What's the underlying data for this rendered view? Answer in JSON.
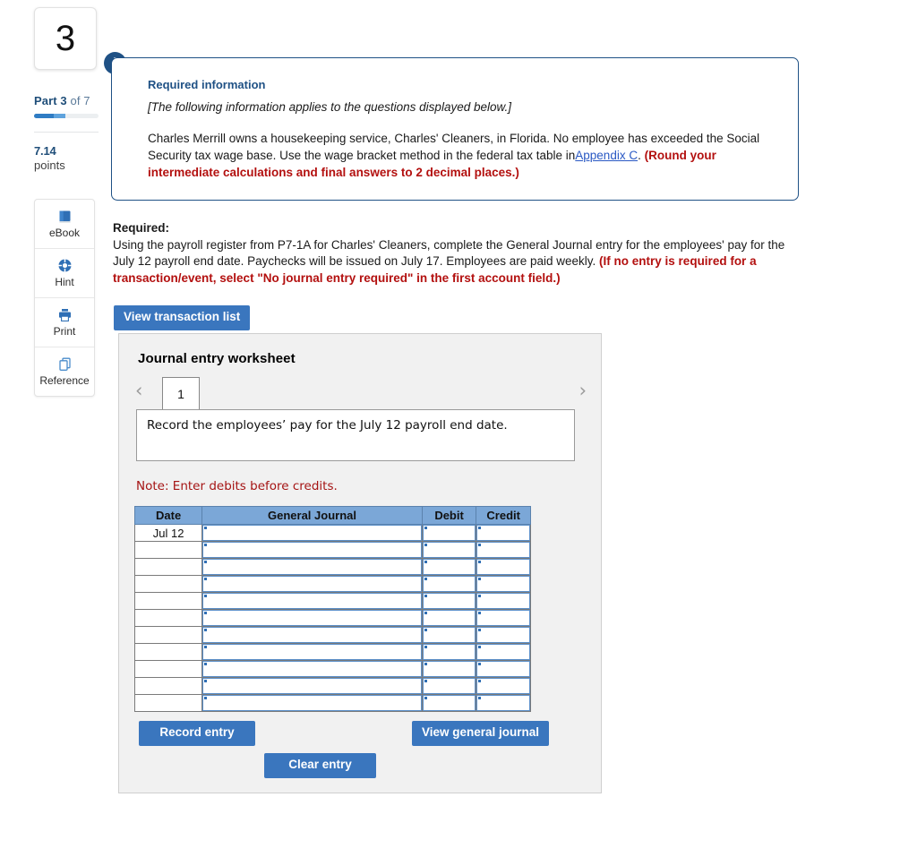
{
  "left_rail": {
    "question_number": "3",
    "part_prefix": "Part",
    "part_current": "3",
    "part_of": "of 7",
    "points_value": "7.14",
    "points_label": "points",
    "tools": [
      {
        "label": "eBook",
        "icon": "book-icon"
      },
      {
        "label": "Hint",
        "icon": "lifebuoy-icon"
      },
      {
        "label": "Print",
        "icon": "printer-icon"
      },
      {
        "label": "Reference",
        "icon": "copy-icon"
      }
    ]
  },
  "required_information": {
    "badge_icon": "exclamation-icon",
    "title": "Required information",
    "italic_note": "[The following information applies to the questions displayed below.]",
    "body_part1": "Charles Merrill owns a housekeeping service, Charles' Cleaners, in Florida. No employee has exceeded the Social Security tax wage base. Use the wage bracket method in the federal tax table in",
    "link_text": "Appendix C",
    "body_part2": ". ",
    "body_red": "(Round your intermediate calculations and final answers to 2 decimal places.)"
  },
  "required_block": {
    "heading": "Required:",
    "body_black": "Using the payroll register from P7-1A for Charles' Cleaners, complete the General Journal entry for the employees' pay for the July 12 payroll end date. Paychecks will be issued on July 17. Employees are paid weekly. ",
    "body_red": "(If no entry is required for a transaction/event, select \"No journal entry required\" in the first account field.)"
  },
  "toolbar": {
    "view_transaction_list_label": "View transaction list"
  },
  "worksheet": {
    "title": "Journal entry worksheet",
    "pager_prev_icon": "chevron-left-icon",
    "pager_next_icon": "chevron-right-icon",
    "pager_tabs": [
      "1"
    ],
    "active_tab": "1",
    "transaction_description": "Record the employees’ pay for the July 12 payroll end date.",
    "note": "Note: Enter debits before credits.",
    "table": {
      "headers": [
        "Date",
        "General Journal",
        "Debit",
        "Credit"
      ],
      "rows": [
        {
          "date": "Jul 12",
          "general_journal": "",
          "debit": "",
          "credit": ""
        },
        {
          "date": "",
          "general_journal": "",
          "debit": "",
          "credit": ""
        },
        {
          "date": "",
          "general_journal": "",
          "debit": "",
          "credit": ""
        },
        {
          "date": "",
          "general_journal": "",
          "debit": "",
          "credit": ""
        },
        {
          "date": "",
          "general_journal": "",
          "debit": "",
          "credit": ""
        },
        {
          "date": "",
          "general_journal": "",
          "debit": "",
          "credit": ""
        },
        {
          "date": "",
          "general_journal": "",
          "debit": "",
          "credit": ""
        },
        {
          "date": "",
          "general_journal": "",
          "debit": "",
          "credit": ""
        },
        {
          "date": "",
          "general_journal": "",
          "debit": "",
          "credit": ""
        },
        {
          "date": "",
          "general_journal": "",
          "debit": "",
          "credit": ""
        },
        {
          "date": "",
          "general_journal": "",
          "debit": "",
          "credit": ""
        }
      ]
    },
    "buttons": {
      "record_entry": "Record entry",
      "clear_entry": "Clear entry",
      "view_general_journal": "View general journal"
    }
  },
  "colors": {
    "accent_blue": "#3a76be",
    "header_blue": "#7ba7d7",
    "dark_navy": "#1f5185",
    "alert_red": "#b3100f",
    "note_red": "#a51414",
    "link_blue": "#2a59c4",
    "panel_gray": "#f1f1f1"
  }
}
